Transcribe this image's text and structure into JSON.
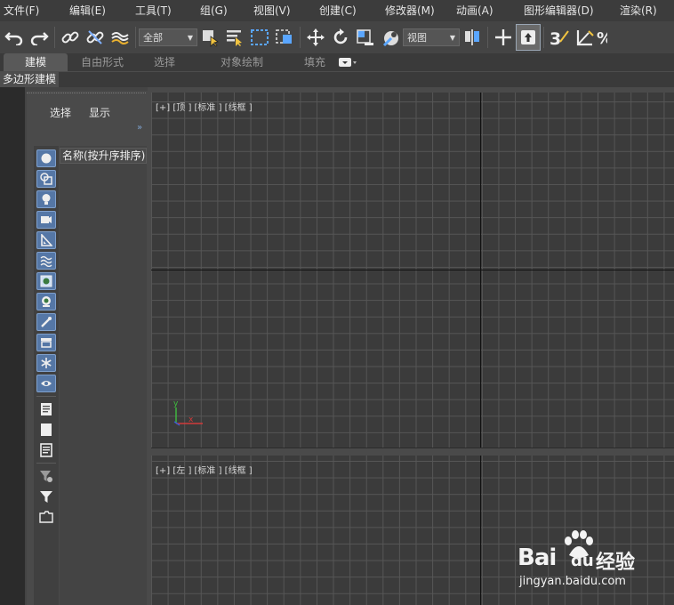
{
  "menu": [
    "文件(F)",
    "编辑(E)",
    "工具(T)",
    "组(G)",
    "视图(V)",
    "创建(C)",
    "修改器(M)",
    "动画(A)",
    "图形编辑器(D)",
    "渲染(R)"
  ],
  "toolbar": {
    "selection_set": "全部",
    "reference_coord": "视图"
  },
  "ribbon": {
    "tabs": [
      "建模",
      "自由形式",
      "选择",
      "对象绘制",
      "填充"
    ],
    "active": "建模",
    "sub_label": "多边形建模"
  },
  "explorer": {
    "tabs": [
      "选择",
      "显示"
    ],
    "expand": "»",
    "column_header": "名称(按升序排序)"
  },
  "viewports": {
    "top_label": "[+] [顶 ] [标准 ] [线框 ]",
    "left_label": "[+] [左 ] [标准 ] [线框 ]",
    "axis_y": "y",
    "axis_x": "x"
  },
  "watermark": {
    "brand": "Bai",
    "brand2": "du",
    "cn": "经验",
    "url": "jingyan.baidu.com"
  },
  "colors": {
    "accent_blue": "#5577a6",
    "gizmo_green": "#3fbf3f",
    "gizmo_red": "#d23a3a",
    "gizmo_blue": "#3a5ad2"
  }
}
